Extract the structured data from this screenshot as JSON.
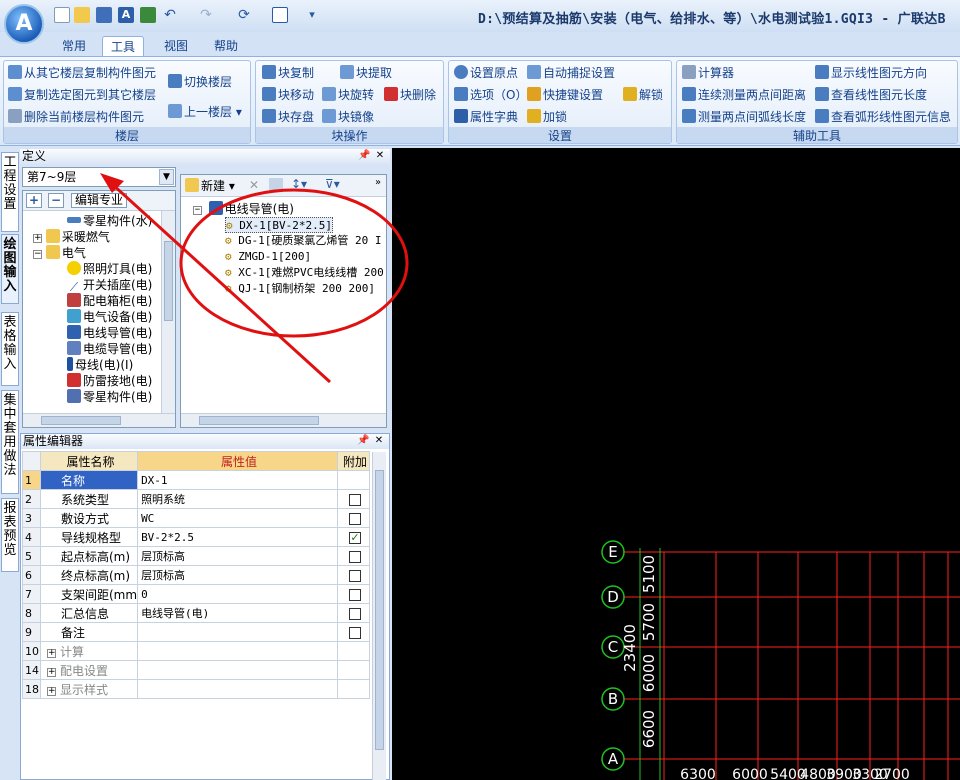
{
  "titlebar": {
    "title": "D:\\预结算及抽筋\\安装（电气、给排水、等）\\水电测试验1.GQI3 - 广联达B",
    "app_letter": "A"
  },
  "tabs": [
    "常用",
    "工具",
    "视图",
    "帮助"
  ],
  "ribbon": {
    "floor": {
      "title": "楼层",
      "copy_from_other": "从其它楼层复制构件图元",
      "copy_selected": "复制选定图元到其它楼层",
      "delete_current": "删除当前楼层构件图元",
      "switch_floor": "切换楼层",
      "prev_floor": "上一楼层"
    },
    "block": {
      "title": "块操作",
      "copy": "块复制",
      "extract": "块提取",
      "move": "块移动",
      "rotate": "块旋转",
      "delete": "块删除",
      "store": "块存盘",
      "mirror": "块镜像"
    },
    "settings": {
      "title": "设置",
      "origin": "设置原点",
      "auto_snap": "自动捕捉设置",
      "options": "选项（O）",
      "shortcut": "快捷键设置",
      "unlock": "解锁",
      "dictionary": "属性字典",
      "lock": "加锁"
    },
    "aux": {
      "title": "辅助工具",
      "calculator": "计算器",
      "show_direction": "显示线性图元方向",
      "measure_continuous": "连续测量两点间距离",
      "view_length": "查看线性图元长度",
      "measure_arc": "测量两点间弧线长度",
      "view_arc": "查看弧形线性图元信息"
    }
  },
  "left_tabs": [
    "工程设置",
    "绘图输入",
    "表格输入",
    "集中套用做法",
    "报表预览"
  ],
  "define": {
    "title": "定义",
    "floor_select": "第7~9层",
    "edit_specialty": "编辑专业",
    "tree": [
      "零星构件(水)",
      "采暖燃气",
      "电气",
      "照明灯具(电)",
      "开关插座(电)",
      "配电箱柜(电)",
      "电气设备(电)",
      "电线导管(电)",
      "电缆导管(电)",
      "母线(电)(I)",
      "防雷接地(电)",
      "零星构件(电)"
    ],
    "new_label": "新建",
    "components": {
      "root": "电线导管(电)",
      "items": [
        "DX-1[BV-2*2.5]",
        "DG-1[硬质聚氯乙烯管 20 I",
        "ZMGD-1[200]",
        "XC-1[难燃PVC电线线槽 200",
        "QJ-1[钢制桥架 200 200]"
      ]
    }
  },
  "props": {
    "title": "属性编辑器",
    "headers": [
      "属性名称",
      "属性值",
      "附加"
    ],
    "rows": [
      {
        "num": "1",
        "name": "名称",
        "value": "DX-1",
        "check": ""
      },
      {
        "num": "2",
        "name": "系统类型",
        "value": "照明系统",
        "check": "false"
      },
      {
        "num": "3",
        "name": "敷设方式",
        "value": "WC",
        "check": "false"
      },
      {
        "num": "4",
        "name": "导线规格型",
        "value": "BV-2*2.5",
        "check": "true"
      },
      {
        "num": "5",
        "name": "起点标高(m)",
        "value": "层顶标高",
        "check": "false"
      },
      {
        "num": "6",
        "name": "终点标高(m)",
        "value": "层顶标高",
        "check": "false"
      },
      {
        "num": "7",
        "name": "支架间距(mm",
        "value": "0",
        "check": "false"
      },
      {
        "num": "8",
        "name": "汇总信息",
        "value": "电线导管(电)",
        "check": "false"
      },
      {
        "num": "9",
        "name": "备注",
        "value": "",
        "check": "false"
      },
      {
        "num": "10",
        "name": "计算",
        "value": "",
        "check": "",
        "group": true
      },
      {
        "num": "14",
        "name": "配电设置",
        "value": "",
        "check": "",
        "group": true
      },
      {
        "num": "18",
        "name": "显示样式",
        "value": "",
        "check": "",
        "group": true
      }
    ]
  },
  "canvas": {
    "axes": [
      "E",
      "D",
      "C",
      "B",
      "A"
    ],
    "vdims": [
      "5100",
      "5700",
      "6000",
      "6600"
    ],
    "total": "23400",
    "hdims": [
      "6300",
      "6000",
      "5400",
      "4800",
      "3900",
      "3300",
      "2700"
    ]
  },
  "colors": {
    "canvas_bg": "#000000",
    "grid_red": "#ff2020",
    "dim_green": "#20c020",
    "annotation_red": "#e01010"
  }
}
